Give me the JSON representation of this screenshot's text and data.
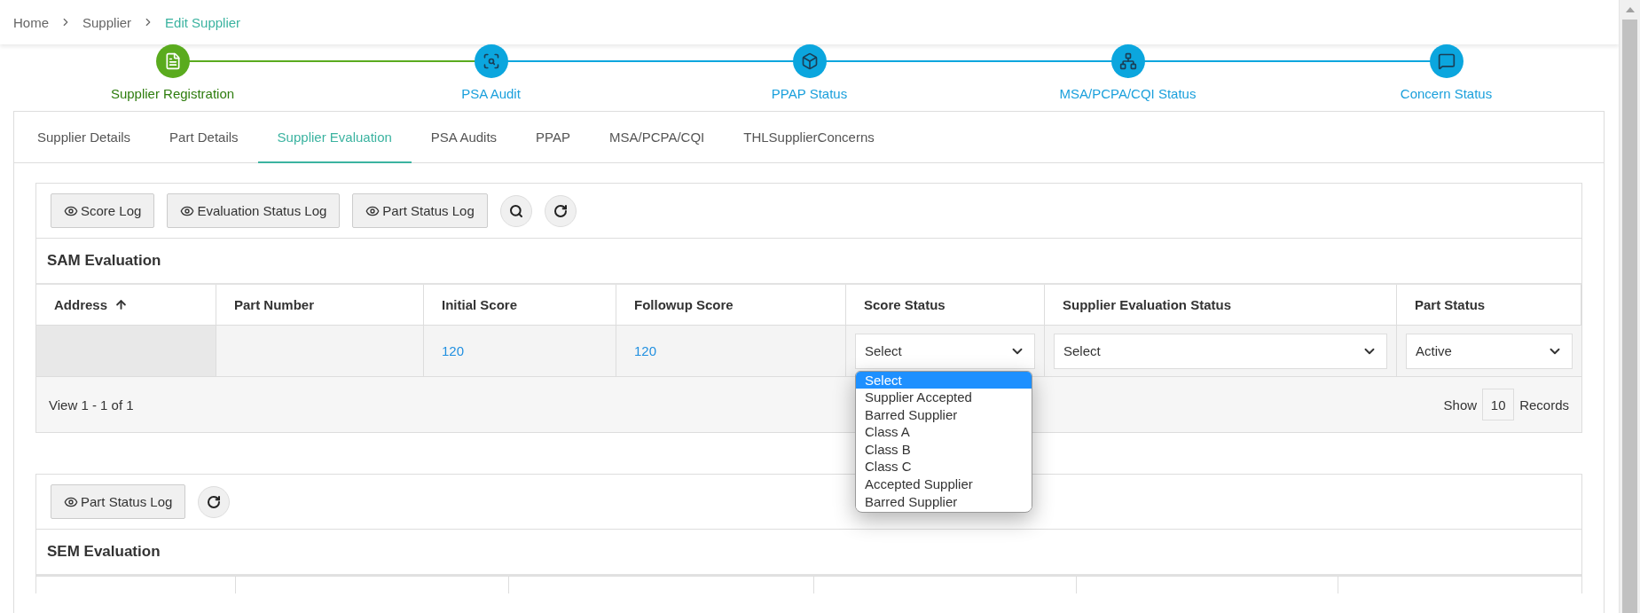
{
  "breadcrumb": [
    {
      "label": "Home",
      "current": false
    },
    {
      "label": "Supplier",
      "current": false
    },
    {
      "label": "Edit Supplier",
      "current": true
    }
  ],
  "steps": [
    {
      "label": "Supplier Registration",
      "completed": true
    },
    {
      "label": "PSA Audit",
      "completed": false
    },
    {
      "label": "PPAP Status",
      "completed": false
    },
    {
      "label": "MSA/PCPA/CQI Status",
      "completed": false
    },
    {
      "label": "Concern Status",
      "completed": false
    }
  ],
  "tabs": [
    {
      "label": "Supplier Details",
      "selected": false
    },
    {
      "label": "Part Details",
      "selected": false
    },
    {
      "label": "Supplier Evaluation",
      "selected": true
    },
    {
      "label": "PSA Audits",
      "selected": false
    },
    {
      "label": "PPAP",
      "selected": false
    },
    {
      "label": "MSA/PCPA/CQI",
      "selected": false
    },
    {
      "label": "THLSupplierConcerns",
      "selected": false
    }
  ],
  "sam_section": {
    "toolbar": [
      {
        "kind": "log",
        "label": "Score Log"
      },
      {
        "kind": "log",
        "label": "Evaluation Status Log"
      },
      {
        "kind": "log",
        "label": "Part Status Log"
      },
      {
        "kind": "search"
      },
      {
        "kind": "refresh"
      }
    ],
    "title": "SAM Evaluation",
    "columns": [
      {
        "label": "Address",
        "sorted": true
      },
      {
        "label": "Part Number",
        "sorted": false
      },
      {
        "label": "Initial Score",
        "sorted": false
      },
      {
        "label": "Followup Score",
        "sorted": false
      },
      {
        "label": "Score Status",
        "sorted": false
      },
      {
        "label": "Supplier Evaluation Status",
        "sorted": false
      },
      {
        "label": "Part Status",
        "sorted": false
      }
    ],
    "rows": [
      {
        "address": "",
        "part_number": "",
        "initial_score": "120",
        "followup_score": "120",
        "score_status": {
          "value": "Select",
          "open": true,
          "options": [
            {
              "label": "Select",
              "selected": true
            },
            {
              "label": "Supplier Accepted",
              "selected": false
            },
            {
              "label": "Barred Supplier",
              "selected": false
            },
            {
              "label": "Class A",
              "selected": false
            },
            {
              "label": "Class B",
              "selected": false
            },
            {
              "label": "Class C",
              "selected": false
            },
            {
              "label": "Accepted Supplier",
              "selected": false
            },
            {
              "label": "Barred Supplier",
              "selected": false
            }
          ]
        },
        "supplier_evaluation_status": {
          "value": "Select"
        },
        "part_status": {
          "value": "Active"
        }
      }
    ],
    "pager": {
      "view": "View 1 - 1 of 1",
      "show": "Show",
      "page_size": "10",
      "records": "Records"
    }
  },
  "sem_section": {
    "toolbar": [
      {
        "kind": "log",
        "label": "Part Status Log"
      },
      {
        "kind": "refresh"
      }
    ],
    "title": "SEM Evaluation"
  }
}
